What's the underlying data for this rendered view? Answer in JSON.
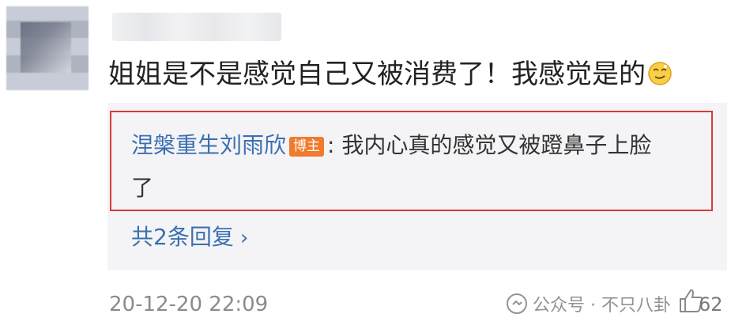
{
  "comment": {
    "text": "姐姐是不是感觉自己又被消费了！我感觉是的",
    "emoji": "smirk-face-emoji"
  },
  "reply": {
    "author": "涅槃重生刘雨欣",
    "badge": "博主",
    "separator": ":",
    "text_line1": "我内心真的感觉又被蹬鼻子上脸",
    "text_line2": "了"
  },
  "more_replies": {
    "label": "共2条回复",
    "chevron": "›"
  },
  "meta": {
    "timestamp": "20-12-20 22:09",
    "watermark": "公众号 · 不只八卦",
    "like_count": "62"
  },
  "colors": {
    "link_blue": "#3b6fb0",
    "badge_orange": "#f07a2d",
    "highlight_red": "#d73b3b",
    "panel_gray": "#f4f4f6"
  }
}
